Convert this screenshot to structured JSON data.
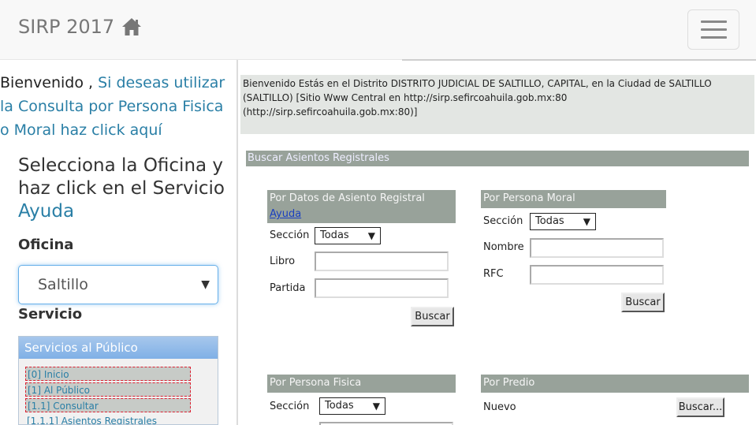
{
  "navbar": {
    "brand": "SIRP 2017",
    "home_icon": "home-icon",
    "menu_icon": "hamburger-menu-icon"
  },
  "welcome": {
    "prefix": "Bienvenido , ",
    "link": "Si deseas utilizar la Consulta por Persona Fisica o Moral haz click aquí"
  },
  "select_office": {
    "title": "Selecciona la Oficina y haz click en el Servicio ",
    "help_link": "Ayuda",
    "oficina_label": "Oficina",
    "oficina_value": "Saltillo",
    "servicio_label": "Servicio"
  },
  "services": {
    "header": "Servicios al Público",
    "items": [
      "[0] Inicio",
      "[1] Al Público",
      "[1.1] Consultar",
      "[1.1.1] Asientos Registrales"
    ]
  },
  "info": {
    "line1": "Bienvenido  Estás en el Distrito DISTRITO JUDICIAL DE SALTILLO, CAPITAL, en la Ciudad de SALTILLO",
    "line2": "(SALTILLO) [Sitio Www Central en http://sirp.sefircoahuila.gob.mx:80",
    "line3": "(http://sirp.sefircoahuila.gob.mx:80)]"
  },
  "search": {
    "title": "Buscar Asientos Registrales",
    "asiento": {
      "header": "Por Datos de Asiento Registral",
      "help": "Ayuda",
      "seccion_label": "Sección",
      "seccion_value": "Todas",
      "libro_label": "Libro",
      "libro_value": "",
      "partida_label": "Partida",
      "partida_value": "",
      "button": "Buscar"
    },
    "moral": {
      "header": "Por Persona Moral",
      "seccion_label": "Sección",
      "seccion_value": "Todas",
      "nombre_label": "Nombre",
      "nombre_value": "",
      "rfc_label": "RFC",
      "rfc_value": "",
      "button": "Buscar"
    },
    "fisica": {
      "header": "Por Persona Fisica",
      "seccion_label": "Sección",
      "seccion_value": "Todas"
    },
    "predio": {
      "header": "Por Predio",
      "nuevo_label": "Nuevo",
      "button": "Buscar..."
    }
  }
}
